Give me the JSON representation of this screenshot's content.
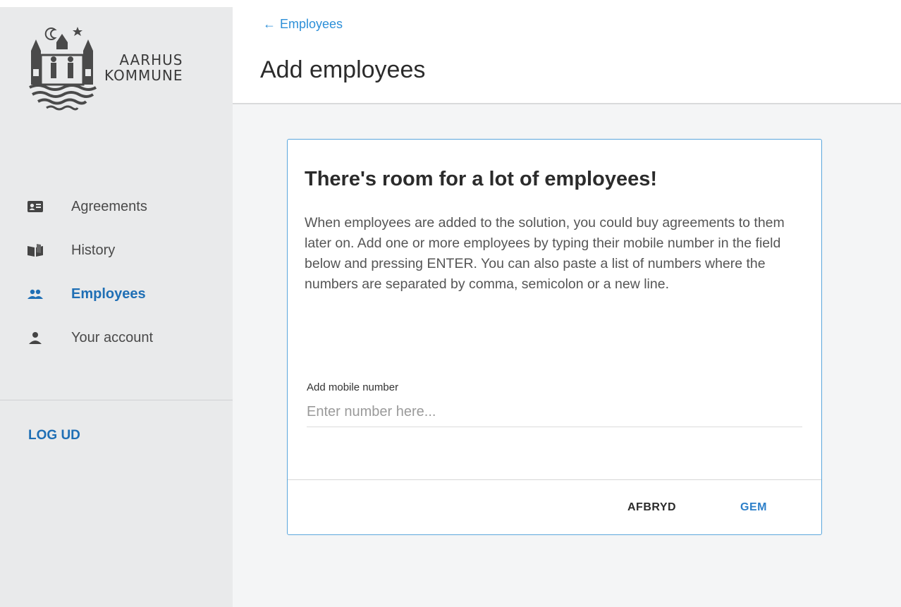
{
  "brand": {
    "name_line1": "AARHUS",
    "name_line2": "KOMMUNE"
  },
  "sidebar": {
    "items": [
      {
        "label": "Agreements",
        "icon": "id-card-icon",
        "active": false
      },
      {
        "label": "History",
        "icon": "open-book-icon",
        "active": false
      },
      {
        "label": "Employees",
        "icon": "people-icon",
        "active": true
      },
      {
        "label": "Your account",
        "icon": "person-icon",
        "active": false
      }
    ],
    "logout_label": "LOG UD"
  },
  "header": {
    "back_label": "Employees",
    "title": "Add employees"
  },
  "card": {
    "title": "There's room for a lot of employees!",
    "body": "When employees are added to the solution, you could buy agreements to them later on. Add one or more employees by typing their mobile number in the field below and pressing ENTER. You can also paste a list of numbers where the numbers are separated by comma, semicolon or a new line.",
    "field_label": "Add mobile number",
    "field_value": "",
    "field_placeholder": "Enter number here...",
    "cancel_label": "AFBRYD",
    "save_label": "GEM"
  },
  "colors": {
    "accent": "#2c8fd8",
    "active_nav": "#1f6fb5",
    "sidebar_bg": "#e9eaeb",
    "card_border": "#5aa6dc"
  }
}
